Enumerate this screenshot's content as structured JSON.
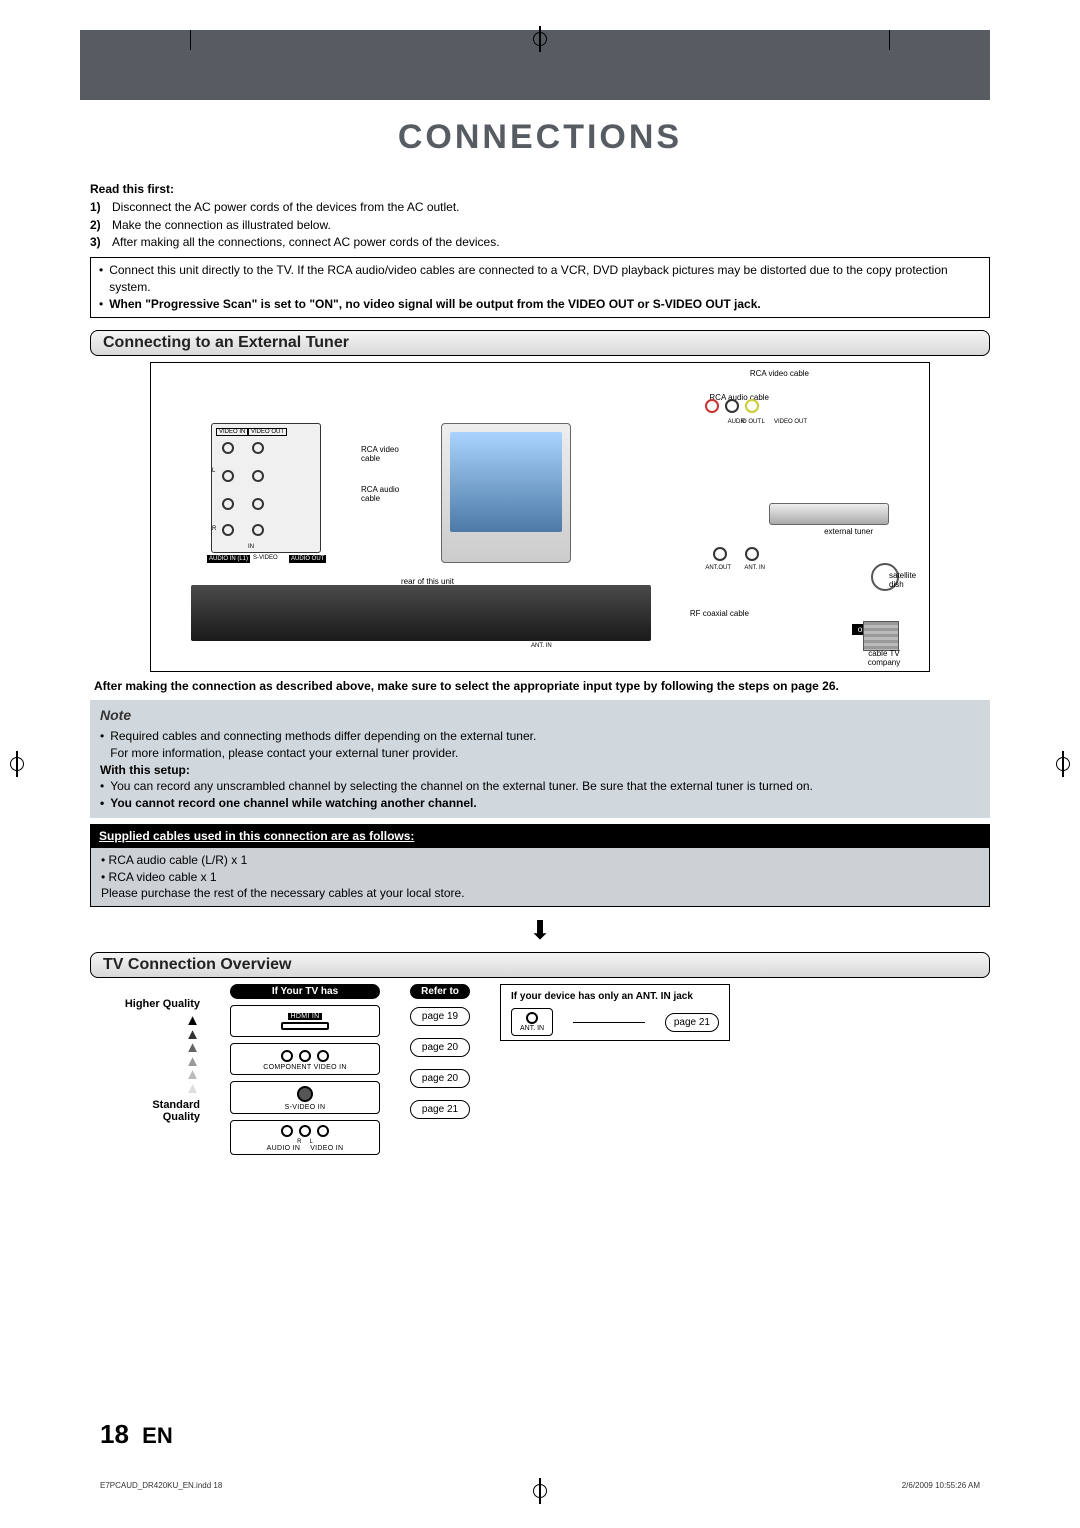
{
  "title": "CONNECTIONS",
  "intro": {
    "heading": "Read this first:",
    "steps": [
      {
        "n": "1)",
        "text": "Disconnect the AC power cords of the devices from the AC outlet."
      },
      {
        "n": "2)",
        "text": "Make the connection as illustrated below."
      },
      {
        "n": "3)",
        "text": "After making all the connections, connect AC power cords of the devices."
      }
    ]
  },
  "warn": {
    "b1": "Connect this unit directly to the TV. If the RCA audio/video cables are connected to a VCR, DVD playback pictures may be distorted due to the copy protection system.",
    "b2": "When \"Progressive Scan\" is set to \"ON\", no video signal will be output from the VIDEO OUT or S-VIDEO OUT jack."
  },
  "section1": {
    "title": "Connecting to an External Tuner"
  },
  "diagram": {
    "rca_video_cable": "RCA video cable",
    "rca_audio_cable": "RCA audio cable",
    "rca_video_cable2": "RCA video cable",
    "rca_audio_cable2": "RCA audio cable",
    "video_in": "VIDEO IN",
    "audio_in": "AUDIO IN",
    "l": "L",
    "r": "R",
    "video_in_top": "VIDEO IN",
    "video_out_top": "VIDEO OUT",
    "audio_out": "AUDIO OUT",
    "video_out": "VIDEO OUT",
    "audio_in_l1": "AUDIO IN (L1)",
    "s_video": "S-VIDEO",
    "audio_out2": "AUDIO OUT",
    "in": "IN",
    "rear_of_unit": "rear of this unit",
    "ant_in": "ANT. IN",
    "ant_out": "ANT.OUT",
    "ant_in2": "ANT. IN",
    "external_tuner": "external tuner",
    "satellite_dish": "satellite dish",
    "rf_coaxial": "RF coaxial cable",
    "or": "or",
    "cable_tv": "cable TV company"
  },
  "bold_note": "After making the connection as described above, make sure to select the appropriate input type by following the steps on page 26.",
  "note_box": {
    "title": "Note",
    "l1": "Required cables and connecting methods differ depending on the external tuner.",
    "l2": "For more information, please contact your external tuner provider.",
    "with_setup": "With this setup:",
    "l3": "You can record any unscrambled channel by selecting the channel on the external tuner. Be sure that the external tuner is turned on.",
    "l4": "You cannot record one channel while watching another channel."
  },
  "supplied": {
    "heading": "Supplied cables used in this connection are as follows:",
    "l1": "• RCA audio cable (L/R) x 1",
    "l2": "• RCA video cable x 1",
    "l3": "Please purchase the rest of the necessary cables at your local store."
  },
  "section2": {
    "title": "TV Connection Overview"
  },
  "overview": {
    "higher_quality": "Higher Quality",
    "standard_quality": "Standard Quality",
    "if_your_tv": "If Your TV has",
    "refer_to": "Refer to",
    "hdmi_in": "HDMI IN",
    "component_in": "COMPONENT VIDEO IN",
    "svideo_in": "S-VIDEO IN",
    "audio_in_r": "R",
    "audio_in_l": "L",
    "audio_in_lbl": "AUDIO IN",
    "video_in_lbl": "VIDEO IN",
    "p19": "page 19",
    "p20a": "page 20",
    "p20b": "page 20",
    "p21": "page 21",
    "ant_heading": "If your device has only an ANT. IN jack",
    "ant_in": "ANT. IN",
    "p21b": "page 21"
  },
  "footer": {
    "page": "18",
    "lang": "EN"
  },
  "print_meta": {
    "left": "E7PCAUD_DR420KU_EN.indd   18",
    "right": "2/6/2009   10:55:26 AM"
  }
}
